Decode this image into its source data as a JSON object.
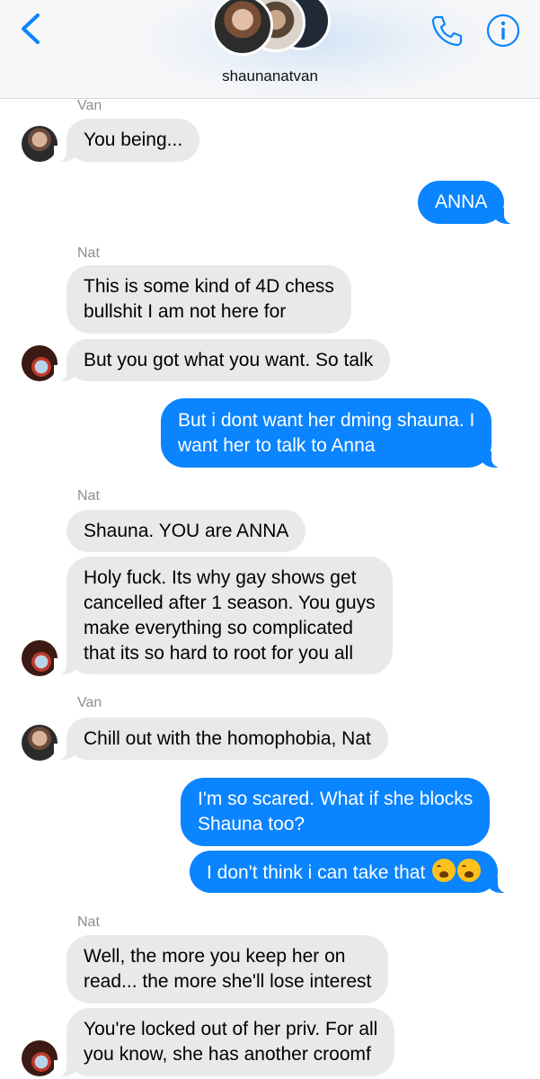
{
  "header": {
    "group_name": "shaunanatvan",
    "icons": [
      "chevron-left-icon",
      "phone-icon",
      "info-icon"
    ],
    "accent_color": "#0a84ff"
  },
  "messages": [
    {
      "sender": "Van",
      "text": "You being...",
      "type": "incoming"
    },
    {
      "text": "ANNA",
      "type": "outgoing"
    },
    {
      "sender": "Nat",
      "lines": [
        "This is some kind of 4D chess",
        "bullshit I am not here for"
      ],
      "type": "incoming"
    },
    {
      "text": "But you got what you want. So talk",
      "type": "incoming"
    },
    {
      "lines": [
        "But i dont want her dming shauna. I",
        "want her to talk to Anna"
      ],
      "type": "outgoing"
    },
    {
      "sender": "Nat",
      "text": "Shauna. YOU are ANNA",
      "type": "incoming"
    },
    {
      "lines": [
        "Holy fuck. Its why gay shows get",
        "cancelled after 1 season. You guys",
        "make everything so complicated",
        "that its so hard to root for you all"
      ],
      "type": "incoming"
    },
    {
      "sender": "Van",
      "text": "Chill out with the homophobia, Nat",
      "type": "incoming"
    },
    {
      "lines": [
        "I'm so scared. What if she blocks",
        "Shauna too?"
      ],
      "type": "outgoing"
    },
    {
      "text": "I don't think i can take that",
      "emoji": "loudly-crying-face-icon",
      "type": "outgoing"
    },
    {
      "sender": "Nat",
      "lines": [
        "Well, the more you keep her on",
        "read... the more she'll lose interest"
      ],
      "type": "incoming"
    },
    {
      "lines": [
        "You're locked out of her priv. For all",
        "you know, she has another croomf"
      ],
      "type": "incoming"
    }
  ]
}
